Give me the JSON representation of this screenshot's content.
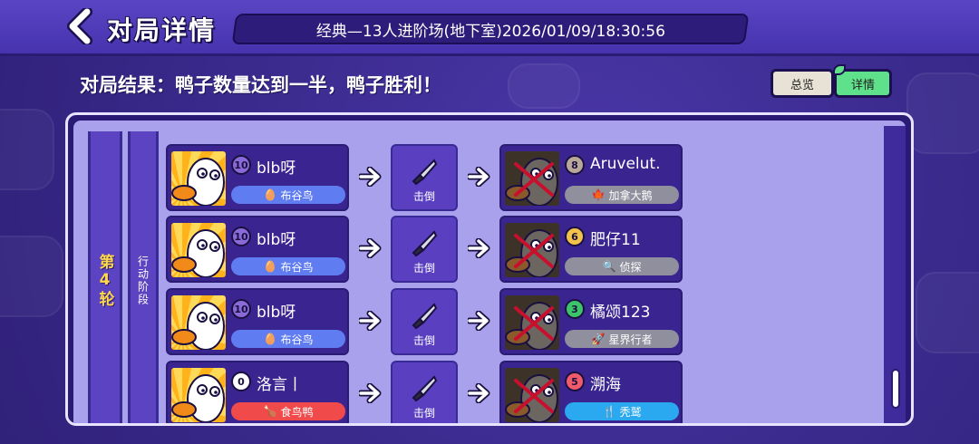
{
  "header": {
    "title": "对局详情",
    "match_info": "经典—13人进阶场(地下室)2026/01/09/18:30:56"
  },
  "result_text": "对局结果：鸭子数量达到一半，鸭子胜利！",
  "tabs": [
    {
      "label": "总览",
      "active": false
    },
    {
      "label": "详情",
      "active": true
    }
  ],
  "round_label": "第4轮",
  "phase_label": "行动阶段",
  "action_label": "击倒",
  "rows": [
    {
      "attacker": {
        "number": "10",
        "badge_color": "#8a6ad8",
        "name": "blb呀",
        "role": "布谷鸟",
        "role_color": "#5f7cf0",
        "role_icon": "egg-icon"
      },
      "victim": {
        "number": "8",
        "badge_color": "#b8a89a",
        "name": "Aruvelut.",
        "role": "加拿大鹅",
        "role_color": "#8f8f9e",
        "role_icon": "maple-leaf-icon"
      }
    },
    {
      "attacker": {
        "number": "10",
        "badge_color": "#8a6ad8",
        "name": "blb呀",
        "role": "布谷鸟",
        "role_color": "#5f7cf0",
        "role_icon": "egg-icon"
      },
      "victim": {
        "number": "6",
        "badge_color": "#f2c24a",
        "name": "肥仔11",
        "role": "侦探",
        "role_color": "#8f8f9e",
        "role_icon": "magnifier-icon"
      }
    },
    {
      "attacker": {
        "number": "10",
        "badge_color": "#8a6ad8",
        "name": "blb呀",
        "role": "布谷鸟",
        "role_color": "#5f7cf0",
        "role_icon": "egg-icon"
      },
      "victim": {
        "number": "3",
        "badge_color": "#3cc46a",
        "name": "橘颂123",
        "role": "星界行者",
        "role_color": "#8f8f9e",
        "role_icon": "star-walker-icon"
      }
    },
    {
      "attacker": {
        "number": "0",
        "badge_color": "#ffffff",
        "name": "洛言丨",
        "role": "食鸟鸭",
        "role_color": "#f04a4a",
        "role_icon": "drumstick-icon"
      },
      "victim": {
        "number": "5",
        "badge_color": "#f05a6a",
        "name": "溯海",
        "role": "秃鹫",
        "role_color": "#2aa8f0",
        "role_icon": "fork-knife-icon"
      }
    }
  ]
}
